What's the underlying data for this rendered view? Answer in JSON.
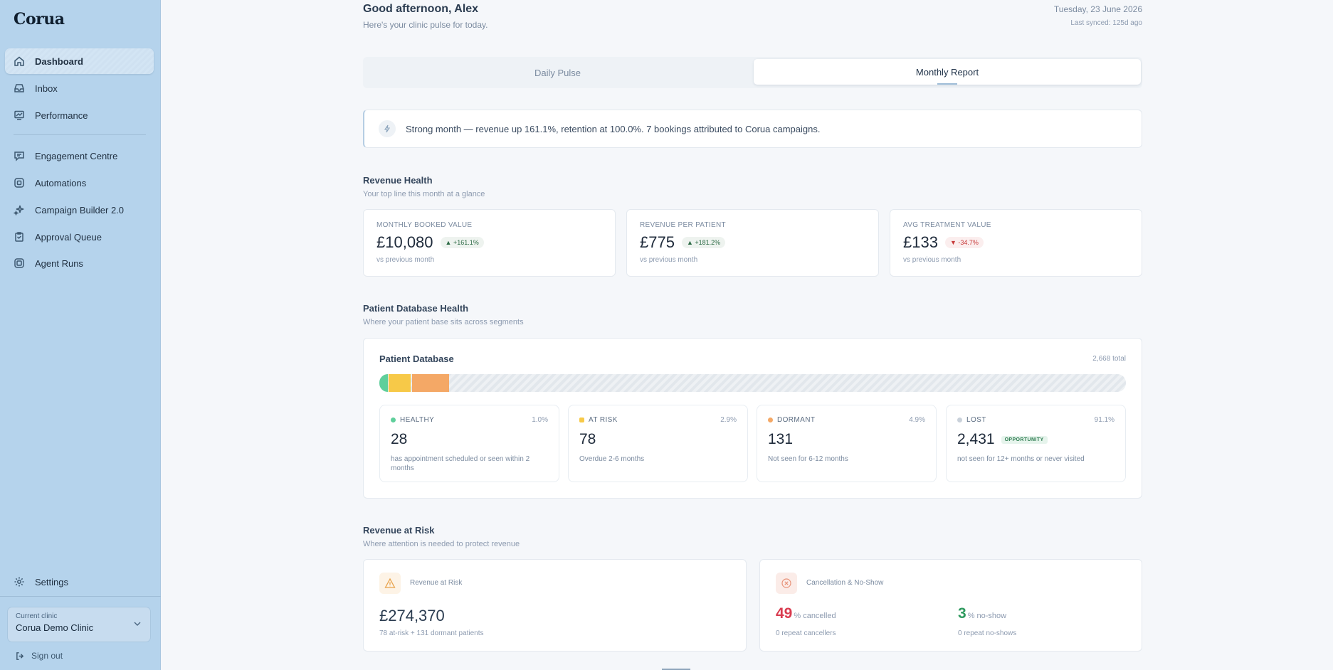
{
  "app": {
    "logo": "Corua"
  },
  "sidebar": {
    "items": [
      {
        "label": "Dashboard",
        "icon": "home-icon"
      },
      {
        "label": "Inbox",
        "icon": "inbox-icon"
      },
      {
        "label": "Performance",
        "icon": "chart-icon"
      },
      {
        "label": "Engagement Centre",
        "icon": "chat-icon"
      },
      {
        "label": "Automations",
        "icon": "automation-icon"
      },
      {
        "label": "Campaign Builder 2.0",
        "icon": "sparkle-icon"
      },
      {
        "label": "Approval Queue",
        "icon": "clipboard-icon"
      },
      {
        "label": "Agent Runs",
        "icon": "agent-icon"
      }
    ],
    "settings": "Settings",
    "clinic_label": "Current clinic",
    "clinic_name": "Corua Demo Clinic",
    "signout": "Sign out"
  },
  "header": {
    "greeting": "Good afternoon, Alex",
    "subtitle": "Here's your clinic pulse for today.",
    "date": "Tuesday, 23 June 2026",
    "synced": "Last synced: 125d ago"
  },
  "tabs": {
    "daily": "Daily Pulse",
    "monthly": "Monthly Report",
    "active": "monthly"
  },
  "banner": {
    "text": "Strong month — revenue up 161.1%, retention at 100.0%. 7 bookings attributed to Corua campaigns."
  },
  "revenue_health": {
    "title": "Revenue Health",
    "subtitle": "Your top line this month at a glance",
    "kpis": [
      {
        "label": "Monthly Booked Value",
        "value": "£10,080",
        "change": "▲ +161.1%",
        "direction": "up",
        "vs": "vs previous month"
      },
      {
        "label": "Revenue Per Patient",
        "value": "£775",
        "change": "▲ +181.2%",
        "direction": "up",
        "vs": "vs previous month"
      },
      {
        "label": "Avg Treatment Value",
        "value": "£133",
        "change": "▼ -34.7%",
        "direction": "down",
        "vs": "vs previous month"
      }
    ]
  },
  "patient_db": {
    "title": "Patient Database Health",
    "subtitle": "Where your patient base sits across segments",
    "card_title": "Patient Database",
    "total": "2,668 total",
    "segments": [
      {
        "name": "HEALTHY",
        "pct": "1.0%",
        "count": "28",
        "desc": "has appointment scheduled or seen within 2 months",
        "color": "#5fcf9b",
        "share": 0.01
      },
      {
        "name": "AT RISK",
        "pct": "2.9%",
        "count": "78",
        "desc": "Overdue 2-6 months",
        "color": "#f7c948",
        "share": 0.029
      },
      {
        "name": "DORMANT",
        "pct": "4.9%",
        "count": "131",
        "desc": "Not seen for 6-12 months",
        "color": "#f4a866",
        "share": 0.049
      },
      {
        "name": "LOST",
        "pct": "91.1%",
        "count": "2,431",
        "desc": "not seen for 12+ months or never visited",
        "color": "#c9d1da",
        "share": 0.911,
        "tag": "OPPORTUNITY"
      }
    ]
  },
  "revenue_risk": {
    "title": "Revenue at Risk",
    "subtitle": "Where attention is needed to protect revenue",
    "risk_card": {
      "label": "Revenue at Risk",
      "value": "£274,370",
      "sub": "78 at-risk + 131 dormant patients"
    },
    "cancel_card": {
      "label": "Cancellation & No-Show",
      "cancelled_value": "49",
      "cancelled_unit": "% cancelled",
      "cancelled_sub": "0 repeat cancellers",
      "noshow_value": "3",
      "noshow_unit": "% no-show",
      "noshow_sub": "0 repeat no-shows"
    }
  },
  "colors": {
    "sidebar": "#b5d3ec",
    "danger": "#d93b4f",
    "success": "#2f9a5f"
  }
}
